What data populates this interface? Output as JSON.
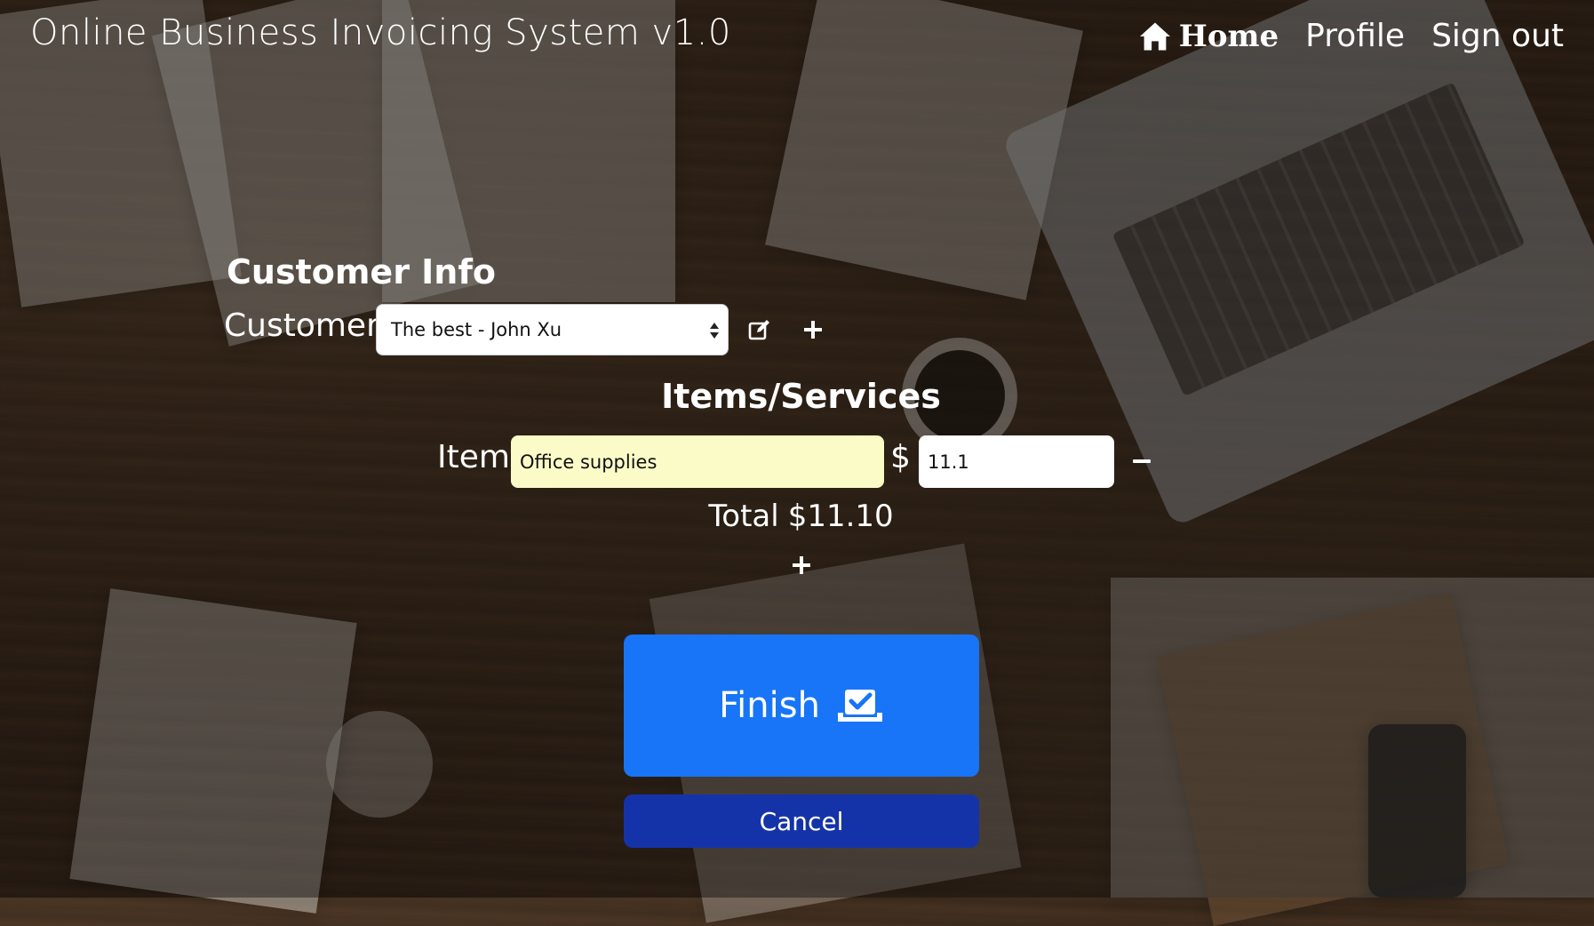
{
  "header": {
    "title": "Online Business Invoicing System v1.0",
    "nav": {
      "home": "Home",
      "profile": "Profile",
      "sign_out": "Sign out"
    }
  },
  "customer_section": {
    "heading": "Customer Info",
    "customer_label": "Customer",
    "selected_customer": "The best - John Xu"
  },
  "items_section": {
    "heading": "Items/Services",
    "item_label": "Item",
    "currency_symbol": "$",
    "items": [
      {
        "name": "Office supplies",
        "price": "11.1"
      }
    ],
    "total_label": "Total",
    "total_value": "$11.10"
  },
  "actions": {
    "finish_label": "Finish",
    "cancel_label": "Cancel"
  },
  "colors": {
    "finish_button": "#1875f7",
    "cancel_button": "#1533a9",
    "item_name_field": "#fbfbc8"
  },
  "icons": {
    "home": "home-icon",
    "edit_customer": "edit-icon",
    "add_customer": "plus-icon",
    "remove_item": "minus-icon",
    "add_item": "plus-icon",
    "finish": "checkbox-check-icon"
  }
}
